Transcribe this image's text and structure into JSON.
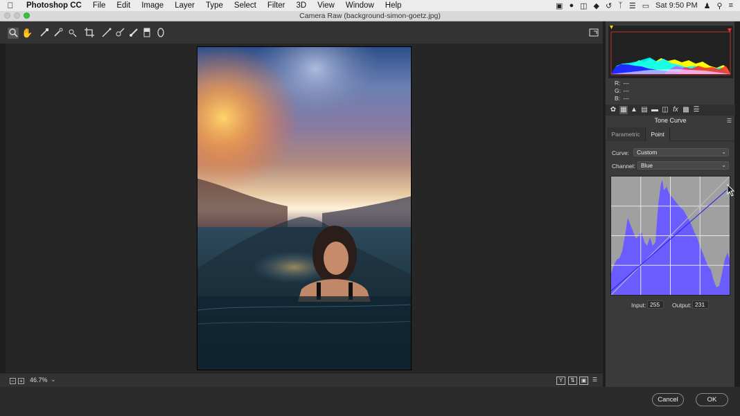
{
  "menubar": {
    "app_name": "Photoshop CC",
    "menus": [
      "File",
      "Edit",
      "Image",
      "Layer",
      "Type",
      "Select",
      "Filter",
      "3D",
      "View",
      "Window",
      "Help"
    ],
    "clock": "Sat 9:50 PM"
  },
  "window": {
    "title": "Camera Raw (background-simon-goetz.jpg)"
  },
  "toolbar": {
    "tools": [
      "zoom-tool",
      "hand-tool",
      "white-balance-tool",
      "color-sampler-tool",
      "targeted-adjustment-tool",
      "crop-tool",
      "straighten-tool",
      "spot-removal-tool",
      "adjustment-brush-tool",
      "graduated-filter-tool",
      "radial-filter-tool"
    ]
  },
  "status": {
    "zoom": "46.7%"
  },
  "panel": {
    "rgb": {
      "r_label": "R:",
      "g_label": "G:",
      "b_label": "B:",
      "r_value": "---",
      "g_value": "---",
      "b_value": "---"
    },
    "title": "Tone Curve",
    "tabs": {
      "parametric": "Parametric",
      "point": "Point"
    },
    "curve_label": "Curve:",
    "curve_value": "Custom",
    "channel_label": "Channel:",
    "channel_value": "Blue",
    "input_label": "Input:",
    "input_value": "255",
    "output_label": "Output:",
    "output_value": "231"
  },
  "buttons": {
    "cancel": "Cancel",
    "ok": "OK"
  },
  "colors": {
    "accent_blue": "#6b5cff",
    "panel_bg": "#3a3a3a"
  }
}
